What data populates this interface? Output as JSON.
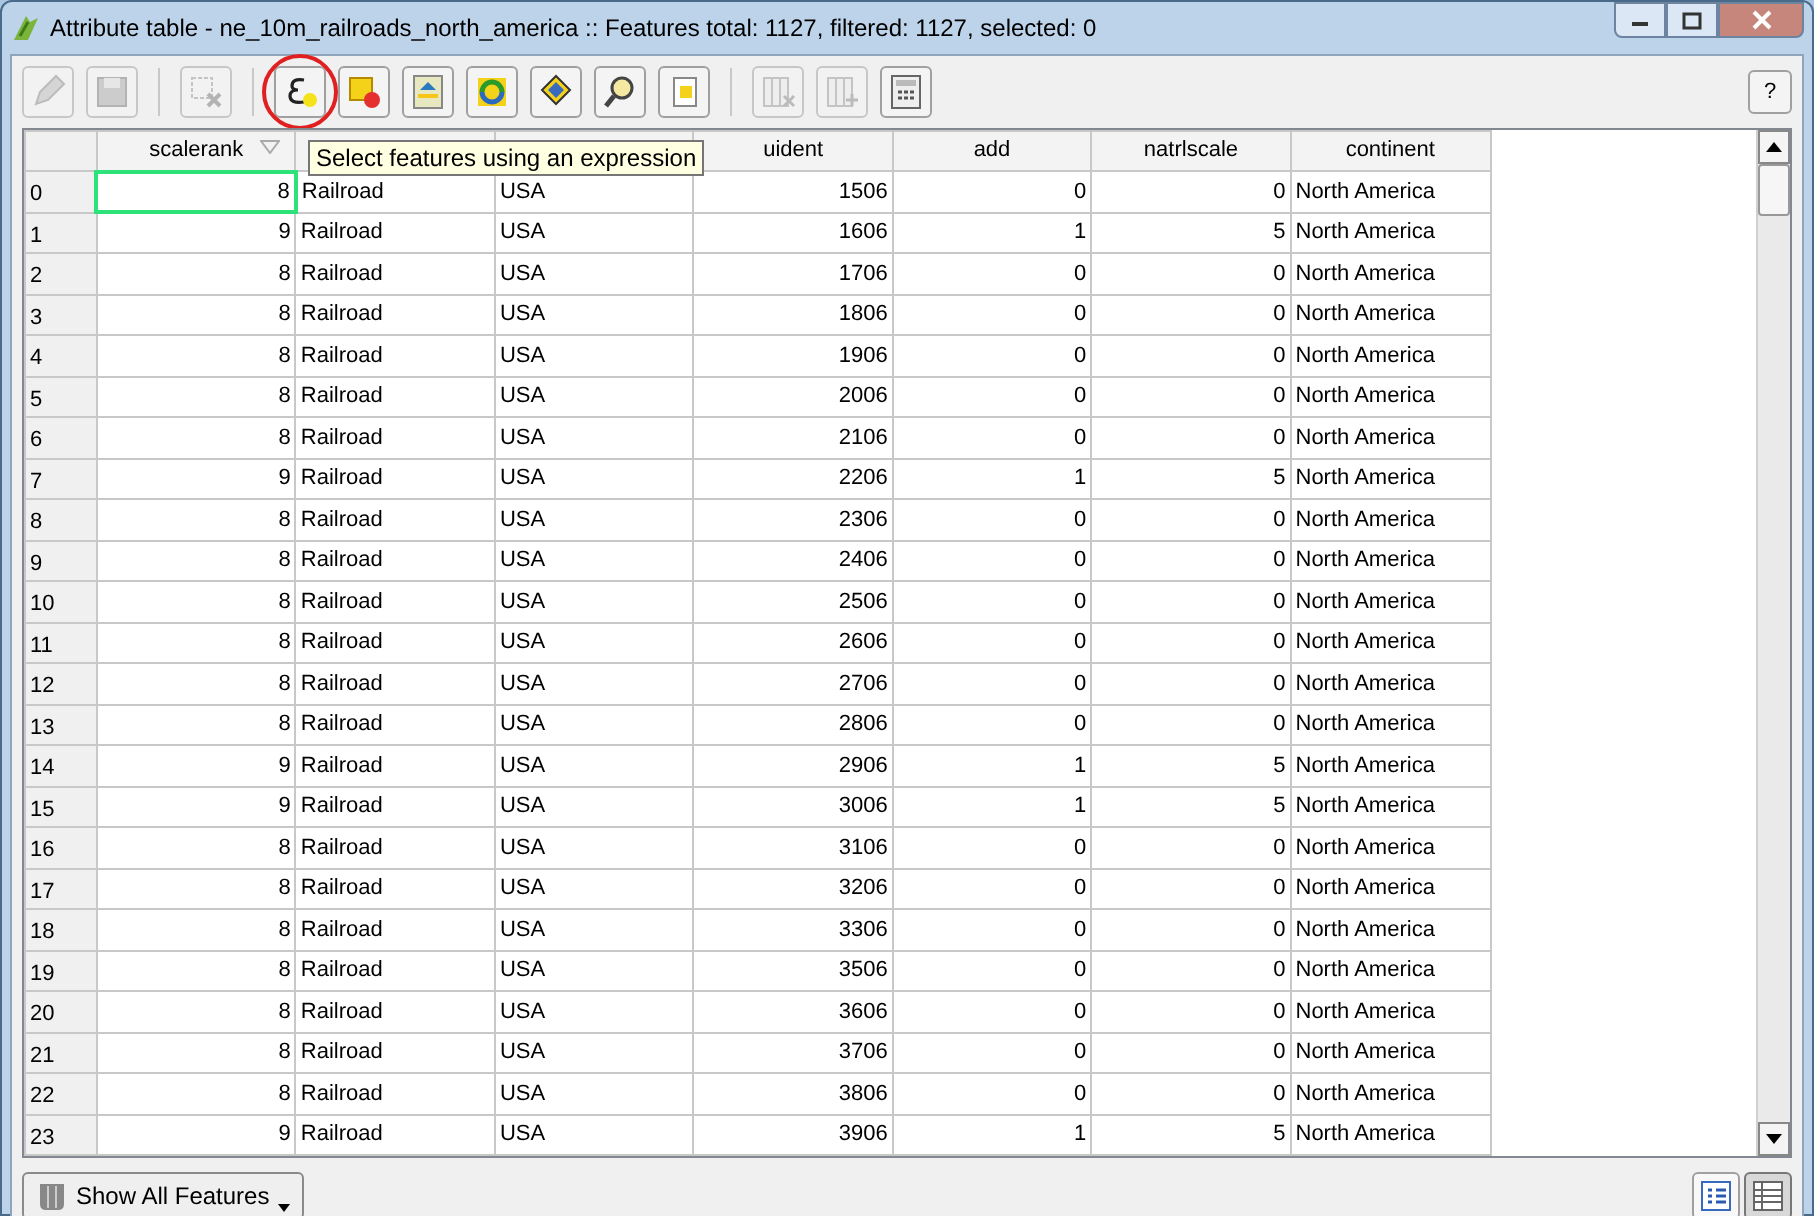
{
  "window": {
    "title": "Attribute table - ne_10m_railroads_north_america :: Features total: 1127, filtered: 1127, selected: 0"
  },
  "toolbar": [
    {
      "kind": "pencil",
      "disabled": true,
      "circled": false
    },
    {
      "kind": "save",
      "disabled": true,
      "circled": false
    },
    {
      "kind": "delete-selection",
      "disabled": true,
      "circled": false
    },
    {
      "kind": "expression",
      "disabled": false,
      "circled": true
    },
    {
      "kind": "deselect",
      "disabled": false,
      "circled": false
    },
    {
      "kind": "move-top",
      "disabled": false,
      "circled": false
    },
    {
      "kind": "invert",
      "disabled": false,
      "circled": false
    },
    {
      "kind": "pan",
      "disabled": false,
      "circled": false
    },
    {
      "kind": "zoom",
      "disabled": false,
      "circled": false
    },
    {
      "kind": "copy",
      "disabled": false,
      "circled": false
    },
    {
      "kind": "delete-column",
      "disabled": true,
      "circled": false
    },
    {
      "kind": "new-column",
      "disabled": true,
      "circled": false
    },
    {
      "kind": "calculator",
      "disabled": false,
      "circled": false
    }
  ],
  "help_button": "?",
  "tooltip": "Select features using an expression",
  "table": {
    "columns": [
      {
        "label": "scalerank",
        "sort": true
      },
      {
        "sort": false
      },
      {
        "sort": false
      },
      {
        "label": "uident",
        "sort": false
      },
      {
        "label": "add",
        "sort": false
      },
      {
        "label": "natrlscale",
        "sort": false
      },
      {
        "label": "continent",
        "sort": false
      }
    ],
    "rows": [
      {
        "number": "0",
        "current": true,
        "cells": [
          "8",
          "Railroad",
          "USA",
          "1506",
          "0",
          "0",
          "North America"
        ]
      },
      {
        "number": "1",
        "current": false,
        "cells": [
          "9",
          "Railroad",
          "USA",
          "1606",
          "1",
          "5",
          "North America"
        ]
      },
      {
        "number": "2",
        "current": false,
        "cells": [
          "8",
          "Railroad",
          "USA",
          "1706",
          "0",
          "0",
          "North America"
        ]
      },
      {
        "number": "3",
        "current": false,
        "cells": [
          "8",
          "Railroad",
          "USA",
          "1806",
          "0",
          "0",
          "North America"
        ]
      },
      {
        "number": "4",
        "current": false,
        "cells": [
          "8",
          "Railroad",
          "USA",
          "1906",
          "0",
          "0",
          "North America"
        ]
      },
      {
        "number": "5",
        "current": false,
        "cells": [
          "8",
          "Railroad",
          "USA",
          "2006",
          "0",
          "0",
          "North America"
        ]
      },
      {
        "number": "6",
        "current": false,
        "cells": [
          "8",
          "Railroad",
          "USA",
          "2106",
          "0",
          "0",
          "North America"
        ]
      },
      {
        "number": "7",
        "current": false,
        "cells": [
          "9",
          "Railroad",
          "USA",
          "2206",
          "1",
          "5",
          "North America"
        ]
      },
      {
        "number": "8",
        "current": false,
        "cells": [
          "8",
          "Railroad",
          "USA",
          "2306",
          "0",
          "0",
          "North America"
        ]
      },
      {
        "number": "9",
        "current": false,
        "cells": [
          "8",
          "Railroad",
          "USA",
          "2406",
          "0",
          "0",
          "North America"
        ]
      },
      {
        "number": "10",
        "current": false,
        "cells": [
          "8",
          "Railroad",
          "USA",
          "2506",
          "0",
          "0",
          "North America"
        ]
      },
      {
        "number": "11",
        "current": false,
        "cells": [
          "8",
          "Railroad",
          "USA",
          "2606",
          "0",
          "0",
          "North America"
        ]
      },
      {
        "number": "12",
        "current": false,
        "cells": [
          "8",
          "Railroad",
          "USA",
          "2706",
          "0",
          "0",
          "North America"
        ]
      },
      {
        "number": "13",
        "current": false,
        "cells": [
          "8",
          "Railroad",
          "USA",
          "2806",
          "0",
          "0",
          "North America"
        ]
      },
      {
        "number": "14",
        "current": false,
        "cells": [
          "9",
          "Railroad",
          "USA",
          "2906",
          "1",
          "5",
          "North America"
        ]
      },
      {
        "number": "15",
        "current": false,
        "cells": [
          "9",
          "Railroad",
          "USA",
          "3006",
          "1",
          "5",
          "North America"
        ]
      },
      {
        "number": "16",
        "current": false,
        "cells": [
          "8",
          "Railroad",
          "USA",
          "3106",
          "0",
          "0",
          "North America"
        ]
      },
      {
        "number": "17",
        "current": false,
        "cells": [
          "8",
          "Railroad",
          "USA",
          "3206",
          "0",
          "0",
          "North America"
        ]
      },
      {
        "number": "18",
        "current": false,
        "cells": [
          "8",
          "Railroad",
          "USA",
          "3306",
          "0",
          "0",
          "North America"
        ]
      },
      {
        "number": "19",
        "current": false,
        "cells": [
          "8",
          "Railroad",
          "USA",
          "3506",
          "0",
          "0",
          "North America"
        ]
      },
      {
        "number": "20",
        "current": false,
        "cells": [
          "8",
          "Railroad",
          "USA",
          "3606",
          "0",
          "0",
          "North America"
        ]
      },
      {
        "number": "21",
        "current": false,
        "cells": [
          "8",
          "Railroad",
          "USA",
          "3706",
          "0",
          "0",
          "North America"
        ]
      },
      {
        "number": "22",
        "current": false,
        "cells": [
          "8",
          "Railroad",
          "USA",
          "3806",
          "0",
          "0",
          "North America"
        ]
      },
      {
        "number": "23",
        "current": false,
        "cells": [
          "9",
          "Railroad",
          "USA",
          "3906",
          "1",
          "5",
          "North America"
        ]
      }
    ]
  },
  "show_features_button": "Show All Features",
  "view_buttons": [
    {
      "kind": "form",
      "selected": false
    },
    {
      "kind": "table",
      "selected": true
    }
  ]
}
